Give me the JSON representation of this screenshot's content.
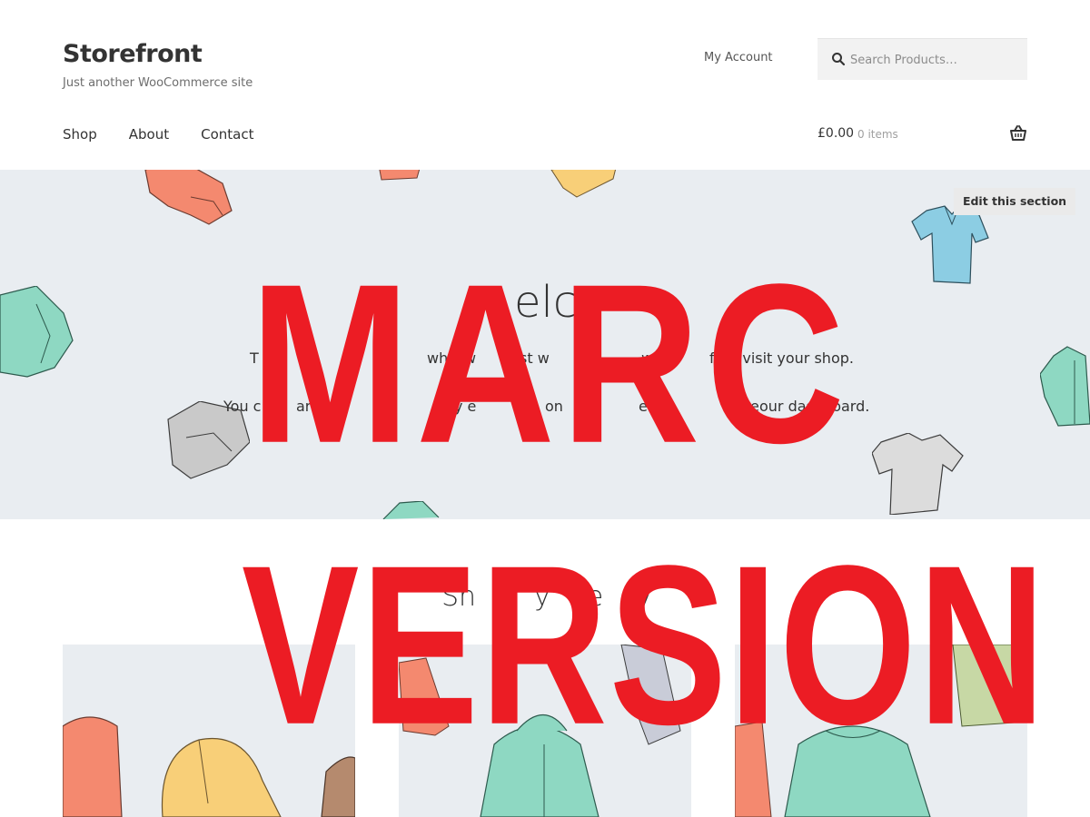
{
  "header": {
    "site_title": "Storefront",
    "site_description": "Just another WooCommerce site",
    "account_link": "My Account",
    "search_placeholder": "Search Products…"
  },
  "nav": {
    "items": [
      {
        "label": "Shop"
      },
      {
        "label": "About"
      },
      {
        "label": "Contact"
      }
    ]
  },
  "cart": {
    "amount": "£0.00",
    "count": "0 items"
  },
  "hero": {
    "edit_button": "Edit this section",
    "title_visible_fragment": "elc",
    "paragraph_1_fragments": [
      "T",
      "wh",
      "w",
      "st w",
      "wh",
      "first visit your shop."
    ],
    "paragraph_2_fragments": [
      "You c",
      "ar",
      "s",
      "y e",
      "on",
      "e",
      "\"P",
      "e",
      "our dashboard."
    ]
  },
  "categories": {
    "title_fragments": [
      "Sh",
      "y",
      "te",
      "y"
    ]
  },
  "overlay": {
    "line_1": "MARC",
    "line_2": "VERSION",
    "color": "#ec1c24"
  },
  "colors": {
    "hero_background": "#e9edf1",
    "text": "#333333",
    "search_background": "#f2f2f2"
  }
}
